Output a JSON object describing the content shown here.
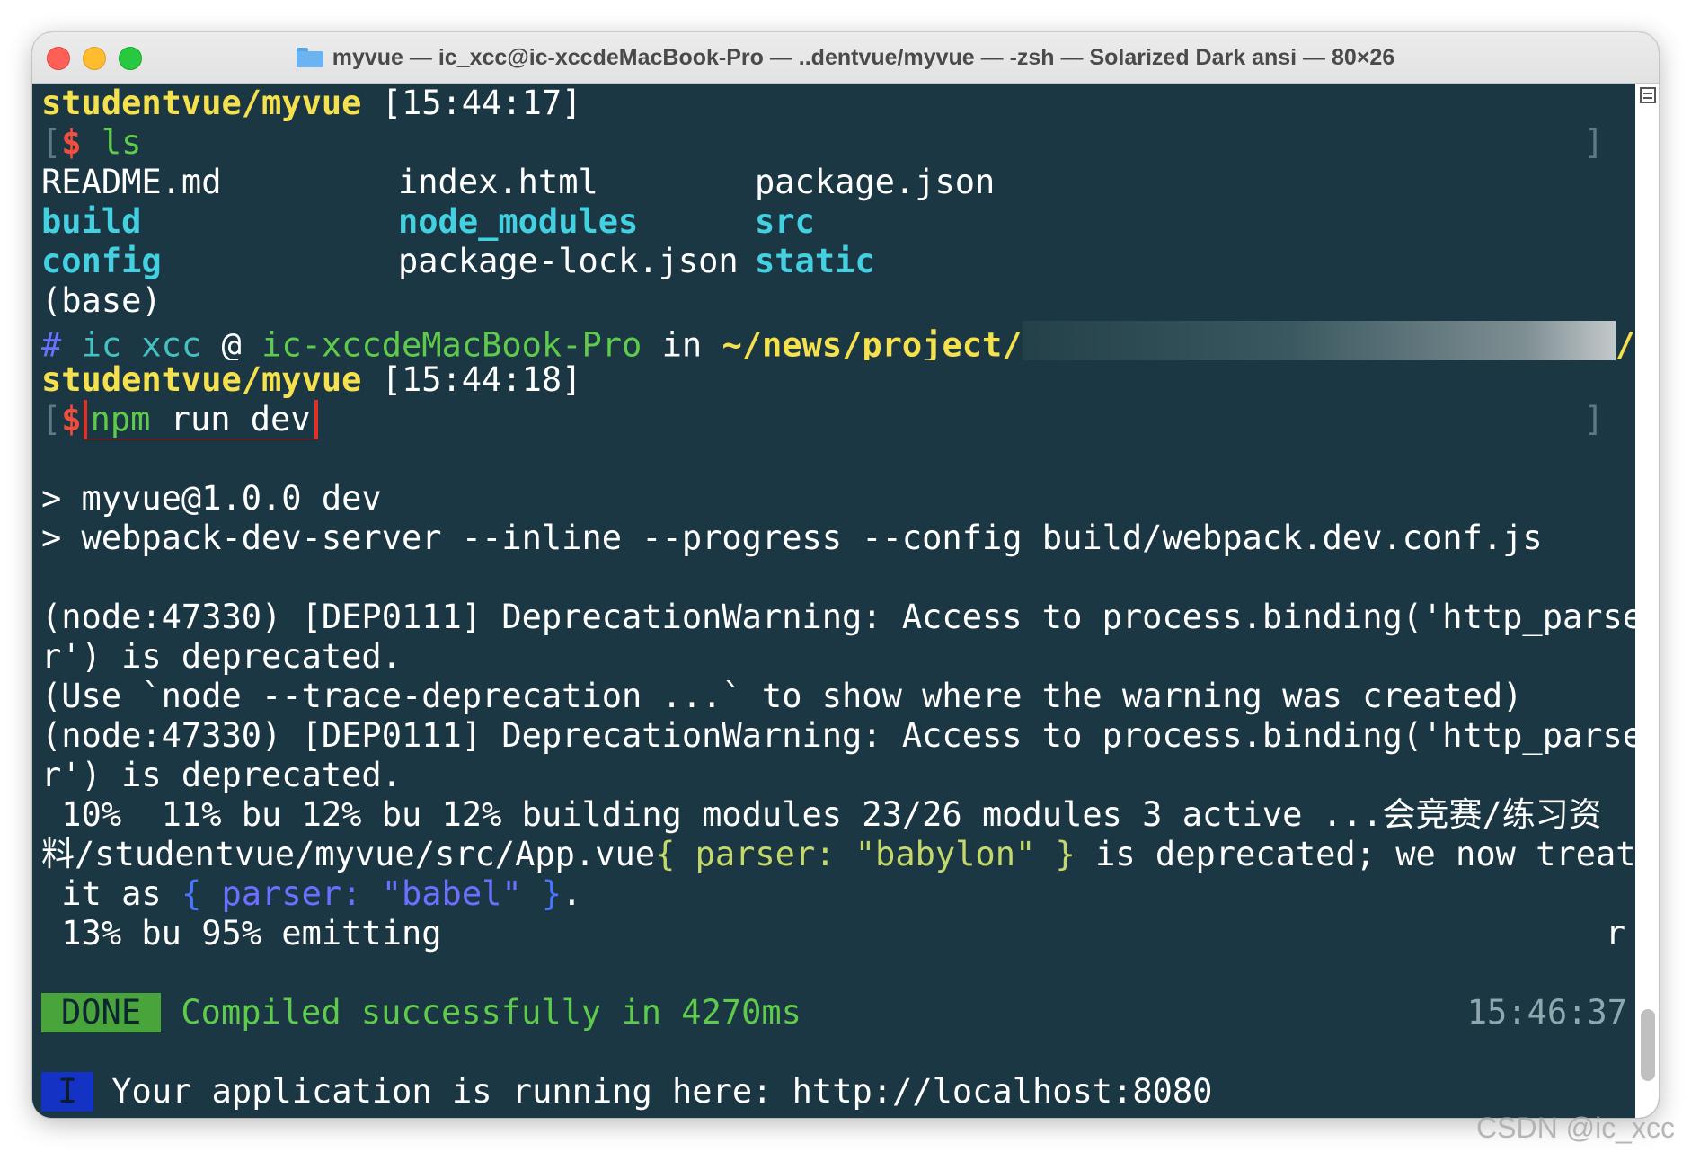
{
  "window": {
    "title": "myvue — ic_xcc@ic-xccdeMacBook-Pro — ..dentvue/myvue — -zsh — Solarized Dark ansi — 80×26"
  },
  "prompt1": {
    "path": "studentvue/myvue",
    "time": "[15:44:17]",
    "dollar": "$",
    "command": "ls"
  },
  "ls_output": {
    "row1": [
      "README.md",
      "index.html",
      "package.json"
    ],
    "row2": [
      "build",
      "node_modules",
      "src"
    ],
    "row3": [
      "config",
      "package-lock.json",
      "static"
    ]
  },
  "base": "(base)",
  "prompt2": {
    "hash": "#",
    "user": "ic_xcc",
    "at": "@",
    "host": "ic-xccdeMacBook-Pro",
    "in": "in",
    "path_start": "~/news/project/",
    "path_end": "/",
    "path2": "studentvue/myvue",
    "time": "[15:44:18]",
    "dollar": "$",
    "cmd_bin": "npm",
    "cmd_args": " run dev"
  },
  "script_lines": [
    "> myvue@1.0.0 dev",
    "> webpack-dev-server --inline --progress --config build/webpack.dev.conf.js"
  ],
  "warnings": [
    "(node:47330) [DEP0111] DeprecationWarning: Access to process.binding('http_parse",
    "r') is deprecated.",
    "(Use `node --trace-deprecation ...` to show where the warning was created)",
    "(node:47330) [DEP0111] DeprecationWarning: Access to process.binding('http_parse",
    "r') is deprecated."
  ],
  "progress": {
    "line1": " 10%  11% bu 12% bu 12% building modules 23/26 modules 3 active ...会竞赛/练习资",
    "line2_start": "料/studentvue/myvue/src/App.vue",
    "line2_obj": "{ parser: \"babylon\" }",
    "line2_end": " is deprecated; we now treat",
    "line3_start": " it as ",
    "line3_brace_open": "{",
    "line3_key": " parser:",
    "line3_val": " \"babel\"",
    "line3_brace_close": " }",
    "line3_end": ".",
    "line4": " 13% bu 95% emitting",
    "line4_right": "r"
  },
  "done": {
    "badge": "DONE",
    "message": "Compiled successfully in 4270ms",
    "time": "15:46:37"
  },
  "info": {
    "badge": "I",
    "message": "Your application is running here: http://localhost:8080"
  },
  "watermark": "CSDN @ic_xcc"
}
